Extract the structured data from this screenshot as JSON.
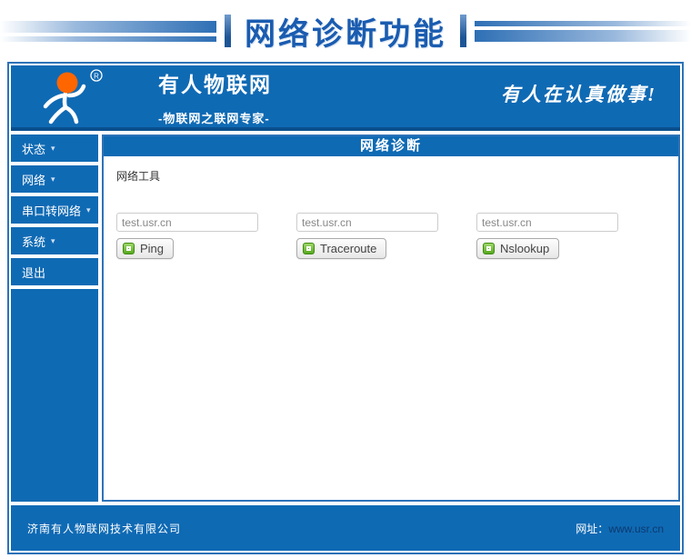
{
  "banner": {
    "title": "网络诊断功能"
  },
  "header": {
    "brand": "有人物联网",
    "tagline": "-物联网之联网专家-",
    "slogan": "有人在认真做事!",
    "registered_mark": "R"
  },
  "sidebar": {
    "arrow": "▾",
    "items": [
      {
        "label": "状态",
        "has_submenu": true
      },
      {
        "label": "网络",
        "has_submenu": true
      },
      {
        "label": "串口转网络",
        "has_submenu": true
      },
      {
        "label": "系统",
        "has_submenu": true
      },
      {
        "label": "退出",
        "has_submenu": false
      }
    ]
  },
  "main": {
    "title": "网络诊断",
    "section_label": "网络工具",
    "tools": [
      {
        "input_value": "test.usr.cn",
        "button_label": "Ping"
      },
      {
        "input_value": "test.usr.cn",
        "button_label": "Traceroute"
      },
      {
        "input_value": "test.usr.cn",
        "button_label": "Nslookup"
      }
    ]
  },
  "footer": {
    "company": "济南有人物联网技术有限公司",
    "website_label": "网址：",
    "website_url": "www.usr.cn"
  },
  "colors": {
    "primary_blue": "#0f6ab4",
    "banner_text_blue": "#1a5cb0",
    "header_border_blue": "#0a4f8e",
    "logo_orange": "#ff6600",
    "link_dark_blue": "#0c3a6e"
  }
}
